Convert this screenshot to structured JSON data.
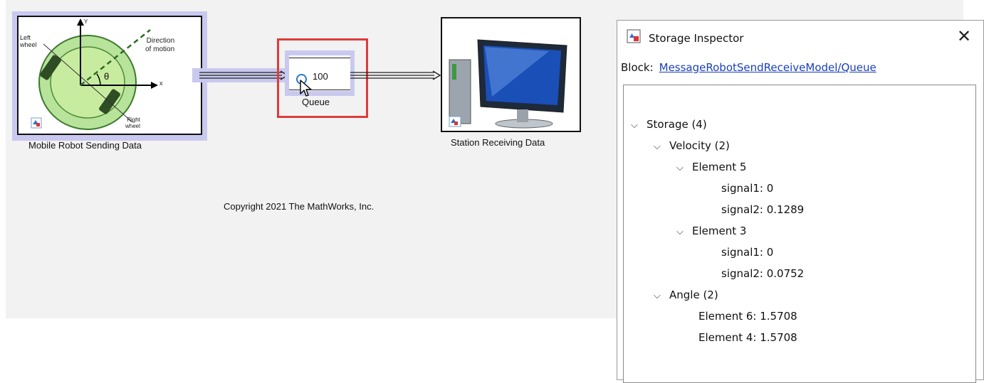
{
  "diagram": {
    "robot_block": {
      "caption": "Mobile Robot Sending Data",
      "labels": {
        "left_wheel": "Left\nwheel",
        "right_wheel": "Right\nwheel",
        "direction": "Direction\nof motion",
        "y_axis": "Y",
        "x_axis": "x",
        "theta": "θ"
      }
    },
    "queue_block": {
      "caption": "Queue",
      "value": "100"
    },
    "station_block": {
      "caption": "Station Receiving Data"
    },
    "copyright": "Copyright 2021 The MathWorks, Inc."
  },
  "inspector": {
    "title": "Storage Inspector",
    "close_glyph": "✕",
    "block_label": "Block:",
    "block_path": "MessageRobotSendReceiveModel/Queue",
    "tree": [
      {
        "text": "Storage  (4)",
        "expanded": true
      },
      {
        "text": "Velocity  (2)",
        "expanded": true
      },
      {
        "text": "Element 5",
        "expanded": true
      },
      {
        "text": "signal1: 0"
      },
      {
        "text": "signal2: 0.1289"
      },
      {
        "text": "Element 3",
        "expanded": true
      },
      {
        "text": "signal1: 0"
      },
      {
        "text": "signal2: 0.0752"
      },
      {
        "text": "Angle  (2)",
        "expanded": true
      },
      {
        "text": "Element 6: 1.5708"
      },
      {
        "text": "Element 4: 1.5708"
      }
    ]
  }
}
